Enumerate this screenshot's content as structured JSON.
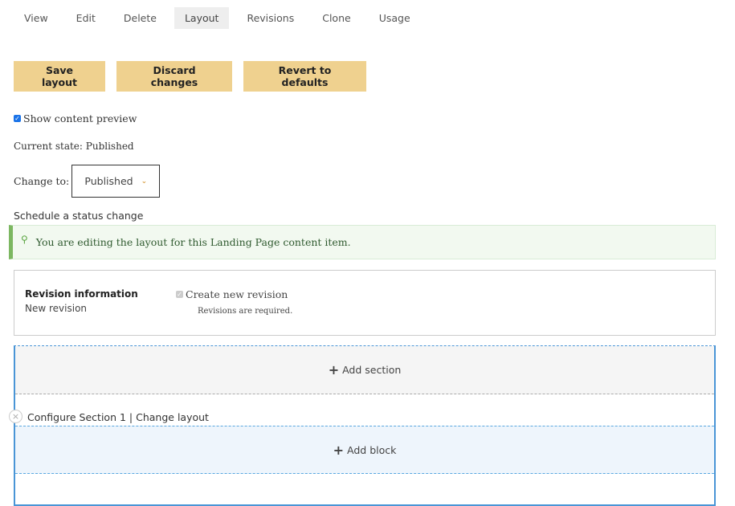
{
  "tabs": [
    {
      "label": "View",
      "active": false
    },
    {
      "label": "Edit",
      "active": false
    },
    {
      "label": "Delete",
      "active": false
    },
    {
      "label": "Layout",
      "active": true
    },
    {
      "label": "Revisions",
      "active": false
    },
    {
      "label": "Clone",
      "active": false
    },
    {
      "label": "Usage",
      "active": false
    }
  ],
  "actions": {
    "save": "Save layout",
    "discard": "Discard changes",
    "revert": "Revert to defaults"
  },
  "preview": {
    "label": "Show content preview",
    "checked": true
  },
  "moderation": {
    "current_state": "Current state: Published",
    "change_to_label": "Change to:",
    "change_to_value": "Published",
    "schedule_link": "Schedule a status change"
  },
  "message": {
    "icon": "map-marker-icon",
    "text": "You are editing the layout for this Landing Page content item."
  },
  "revision": {
    "title": "Revision information",
    "subtitle": "New revision",
    "checkbox_label": "Create new revision",
    "checkbox_checked": true,
    "checkbox_disabled": true,
    "note": "Revisions are required."
  },
  "builder": {
    "add_section": "Add section",
    "configure_section": "Configure Section 1",
    "separator": "|",
    "change_layout": "Change layout",
    "add_block": "Add block"
  },
  "colors": {
    "button_bg": "#efd18f",
    "message_bg": "#f2f9f0",
    "message_accent": "#7cb761",
    "builder_border": "#4a95d6",
    "block_bg": "#eef5fc"
  }
}
